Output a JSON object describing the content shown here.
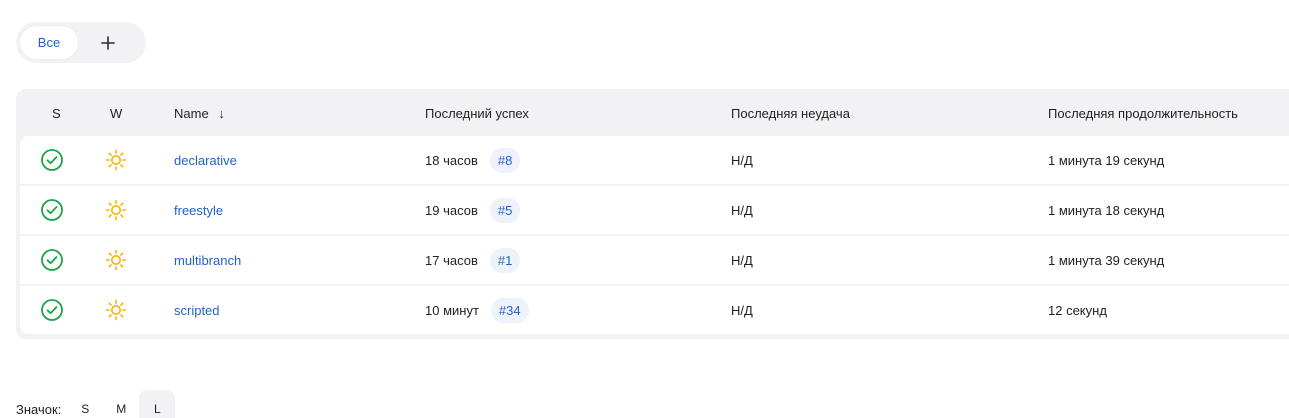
{
  "tabs": {
    "active_label": "Все",
    "add_icon": "plus-icon"
  },
  "table": {
    "headers": {
      "status": "S",
      "weather": "W",
      "name": "Name",
      "sort_indicator": "↓",
      "last_success": "Последний успех",
      "last_failure": "Последняя неудача",
      "last_duration": "Последняя продолжительность"
    },
    "rows": [
      {
        "status_icon": "success-check-icon",
        "weather_icon": "sunny-icon",
        "name": "declarative",
        "last_success": "18 часов",
        "build": "#8",
        "last_failure": "Н/Д",
        "last_duration": "1 минута 19 секунд"
      },
      {
        "status_icon": "success-check-icon",
        "weather_icon": "sunny-icon",
        "name": "freestyle",
        "last_success": "19 часов",
        "build": "#5",
        "last_failure": "Н/Д",
        "last_duration": "1 минута 18 секунд"
      },
      {
        "status_icon": "success-check-icon",
        "weather_icon": "sunny-icon",
        "name": "multibranch",
        "last_success": "17 часов",
        "build": "#1",
        "last_failure": "Н/Д",
        "last_duration": "1 минута 39 секунд"
      },
      {
        "status_icon": "success-check-icon",
        "weather_icon": "sunny-icon",
        "name": "scripted",
        "last_success": "10 минут",
        "build": "#34",
        "last_failure": "Н/Д",
        "last_duration": "12 секунд"
      }
    ]
  },
  "icon_size": {
    "label": "Значок:",
    "options": [
      "S",
      "M",
      "L"
    ],
    "selected": "L"
  },
  "colors": {
    "accent": "#1f63c7",
    "success": "#1ea446",
    "weather": "#f5b300",
    "panel": "#f2f2f5"
  }
}
